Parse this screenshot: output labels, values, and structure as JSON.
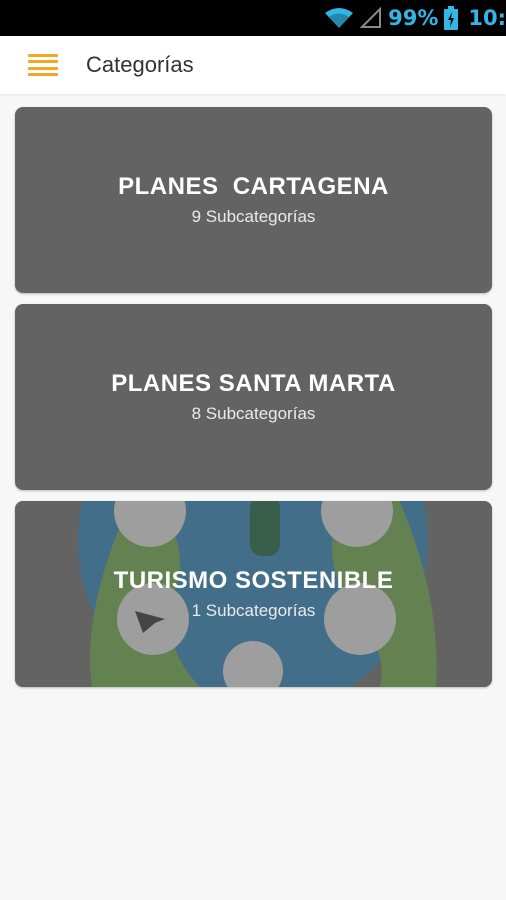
{
  "status_bar": {
    "battery_percent": "99%",
    "time": "10:",
    "accent_color": "#33b5e5"
  },
  "app_bar": {
    "title": "Categorías",
    "menu_icon": "hamburger-menu-icon",
    "accent_color": "#f5a623"
  },
  "categories": [
    {
      "title": "PLANES  CARTAGENA",
      "subtitle": "9 Subcategorías"
    },
    {
      "title": "PLANES SANTA MARTA",
      "subtitle": "8 Subcategorías"
    },
    {
      "title": "TURISMO SOSTENIBLE",
      "subtitle": "1 Subcategorías"
    }
  ]
}
